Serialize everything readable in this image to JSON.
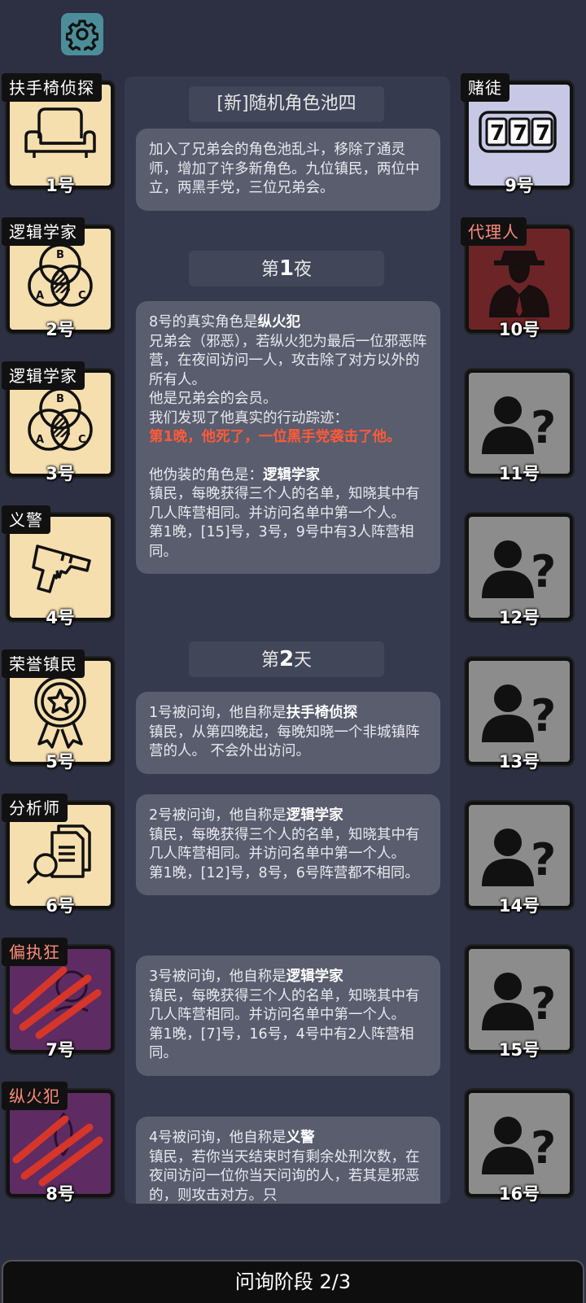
{
  "status_bar_label": "问询阶段 2/3",
  "left_players": [
    {
      "role": "扶手椅侦探",
      "number": "1号",
      "theme": "tan",
      "icon": "armchair-icon"
    },
    {
      "role": "逻辑学家",
      "number": "2号",
      "theme": "tan",
      "icon": "venn-diagram-icon"
    },
    {
      "role": "逻辑学家",
      "number": "3号",
      "theme": "tan",
      "icon": "venn-diagram-icon"
    },
    {
      "role": "义警",
      "number": "4号",
      "theme": "tan",
      "icon": "pistol-icon"
    },
    {
      "role": "荣誉镇民",
      "number": "5号",
      "theme": "tan",
      "icon": "medal-icon"
    },
    {
      "role": "分析师",
      "number": "6号",
      "theme": "tan",
      "icon": "documents-magnifier-icon"
    },
    {
      "role": "偏执狂",
      "number": "7号",
      "theme": "purple",
      "icon": "claw-marks-icon"
    },
    {
      "role": "纵火犯",
      "number": "8号",
      "theme": "purple",
      "icon": "claw-marks-icon"
    }
  ],
  "right_players": [
    {
      "role": "赌徒",
      "number": "9号",
      "theme": "lavender",
      "icon": "slot-machine-777-icon"
    },
    {
      "role": "代理人",
      "number": "10号",
      "theme": "maroon",
      "icon": "suited-agent-icon"
    },
    {
      "role": "",
      "number": "11号",
      "theme": "gray",
      "icon": "unknown-person-icon"
    },
    {
      "role": "",
      "number": "12号",
      "theme": "gray",
      "icon": "unknown-person-icon"
    },
    {
      "role": "",
      "number": "13号",
      "theme": "gray",
      "icon": "unknown-person-icon"
    },
    {
      "role": "",
      "number": "14号",
      "theme": "gray",
      "icon": "unknown-person-icon"
    },
    {
      "role": "",
      "number": "15号",
      "theme": "gray",
      "icon": "unknown-person-icon"
    },
    {
      "role": "",
      "number": "16号",
      "theme": "gray",
      "icon": "unknown-person-icon"
    }
  ],
  "log": {
    "pool_title": "[新]随机角色池四",
    "pool_desc": "加入了兄弟会的角色池乱斗，移除了通灵师，增加了许多新角色。九位镇民，两位中立，两黑手党，三位兄弟会。",
    "night1_prefix": "第",
    "night1_num": "1",
    "night1_suffix": "夜",
    "night_msg": {
      "l1_pre": "8号的真实角色是",
      "l1_role": "纵火犯",
      "l2": "兄弟会（邪恶），若纵火犯为最后一位邪恶阵营，在夜间访问一人，攻击除了对方以外的所有人。",
      "l3": "他是兄弟会的会员。",
      "l4": "我们发现了他真实的行动踪迹：",
      "l5": "第1晚，他死了，一位黑手党袭击了他。",
      "l6_pre": "他伪装的角色是：",
      "l6_role": "逻辑学家",
      "l7": "镇民，每晚获得三个人的名单，知晓其中有几人阵营相同。并访问名单中第一个人。",
      "l8": "第1晚，[15]号，3号，9号中有3人阵营相同。"
    },
    "day2_prefix": "第",
    "day2_num": "2",
    "day2_suffix": "天",
    "q1": {
      "pre": "1号被问询，他自称是",
      "role": "扶手椅侦探",
      "body": "镇民，从第四晚起，每晚知晓一个非城镇阵营的人。 不会外出访问。"
    },
    "q2": {
      "pre": "2号被问询，他自称是",
      "role": "逻辑学家",
      "body": "镇民，每晚获得三个人的名单，知晓其中有几人阵营相同。并访问名单中第一个人。",
      "result": "第1晚，[12]号，8号，6号阵营都不相同。"
    },
    "q3": {
      "pre": "3号被问询，他自称是",
      "role": "逻辑学家",
      "body": "镇民，每晚获得三个人的名单，知晓其中有几人阵营相同。并访问名单中第一个人。",
      "result": "第1晚，[7]号，16号，4号中有2人阵营相同。"
    },
    "q4": {
      "pre": "4号被问询，他自称是",
      "role": "义警",
      "body": "镇民，若你当天结束时有剩余处刑次数，在夜间访问一位你当天问询的人，若其是邪恶的，则攻击对方。只"
    }
  }
}
